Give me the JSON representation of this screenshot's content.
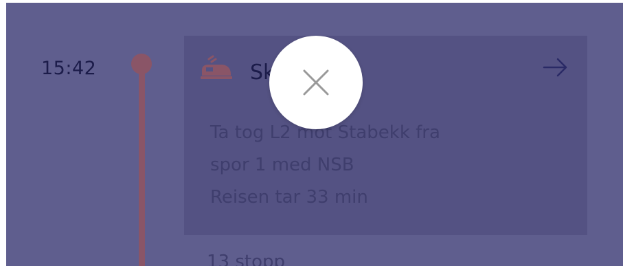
{
  "timeline": {
    "time": "15:42"
  },
  "leg_card": {
    "title": "Sk            on",
    "description": [
      "Ta tog L2 mot Stabekk fra",
      "spor 1 med NSB",
      "Reisen tar 33 min"
    ],
    "train_icon": "train-icon",
    "arrow_icon": "arrow-right-icon"
  },
  "stops_label": "13 stopp",
  "overlay": {
    "close_icon": "close-icon"
  },
  "colors": {
    "overlay_background": "#5f5e8e",
    "card_background": "#545283",
    "timeline_accent": "#8a5567",
    "text_dark": "#1c1c4a",
    "text_muted": "#3f3e6d",
    "close_button_bg": "#ffffff",
    "close_icon_color": "#9a9a9a"
  }
}
